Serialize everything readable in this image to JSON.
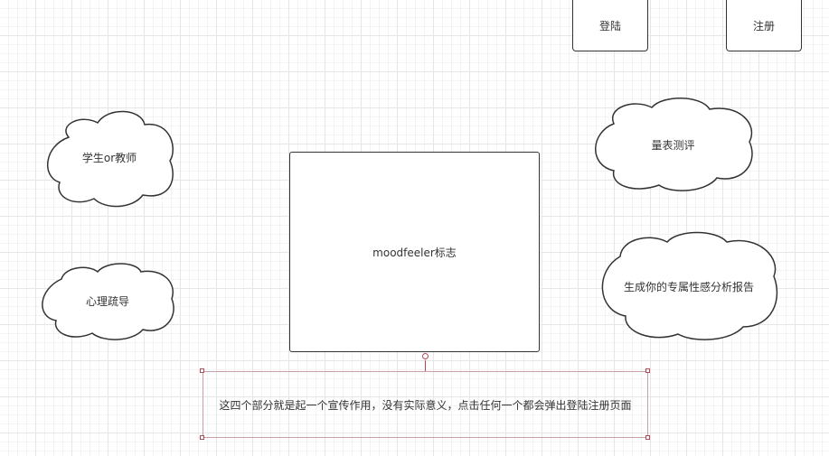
{
  "buttons": {
    "login": "登陆",
    "register": "注册"
  },
  "logo": {
    "label": "moodfeeler标志"
  },
  "clouds": {
    "student_teacher": "学生or教师",
    "counseling": "心理疏导",
    "scale_assessment": "量表测评",
    "report": "生成你的专属性感分析报告"
  },
  "note": {
    "text": "这四个部分就是起一个宣传作用，没有实际意义，点击任何一个都会弹出登陆注册页面"
  },
  "colors": {
    "stroke": "#333333",
    "grid": "#e6e6e6",
    "selection": "#b24a57"
  }
}
